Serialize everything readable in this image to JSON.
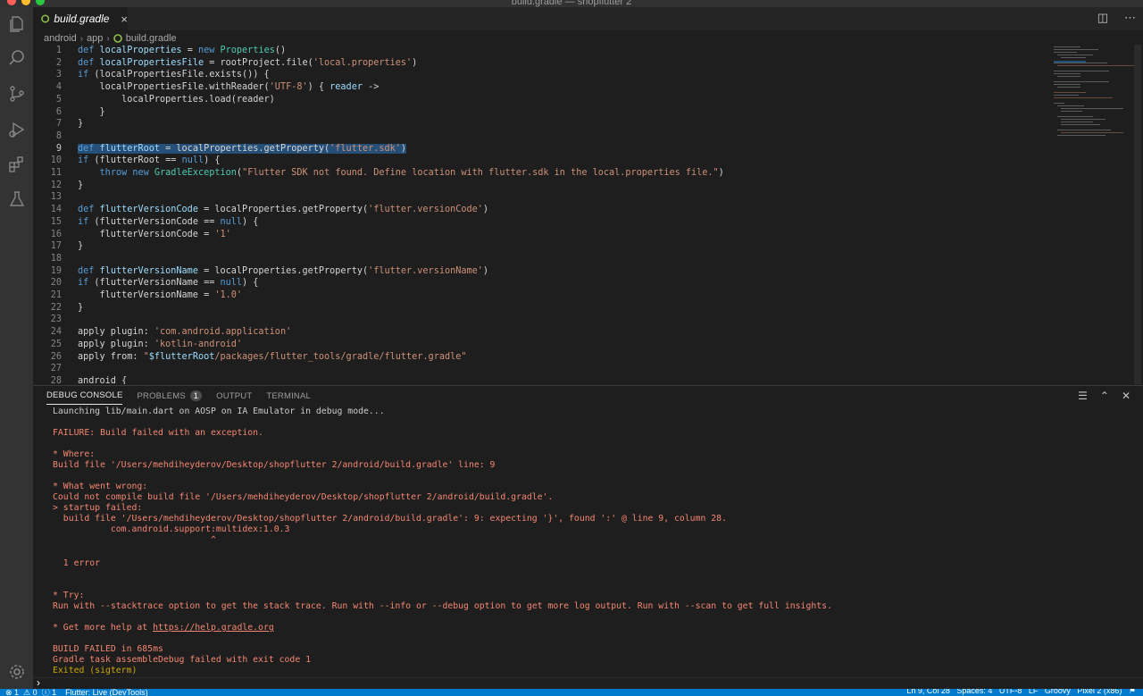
{
  "window": {
    "title": "build.gradle — shopflutter 2"
  },
  "activity_bar": {
    "icons": [
      "files-icon",
      "search-icon",
      "source-control-icon",
      "run-debug-icon",
      "extensions-icon",
      "testing-icon",
      "gear-icon"
    ]
  },
  "tab": {
    "label": "build.gradle",
    "close": "×"
  },
  "breadcrumb": [
    "android",
    "app",
    "build.gradle"
  ],
  "editor": {
    "line_numbers": [
      "1",
      "2",
      "3",
      "4",
      "5",
      "6",
      "7",
      "8",
      "9",
      "10",
      "11",
      "12",
      "13",
      "14",
      "15",
      "16",
      "17",
      "18",
      "19",
      "20",
      "21",
      "22",
      "23",
      "24",
      "25",
      "26",
      "27",
      "28"
    ]
  },
  "panel": {
    "tabs": [
      "DEBUG CONSOLE",
      "PROBLEMS",
      "OUTPUT",
      "TERMINAL"
    ],
    "problems_count": "1",
    "console_lines": [
      "Launching lib/main.dart on AOSP on IA Emulator in debug mode...",
      "FAILURE: Build failed with an exception.",
      "* Where:",
      "Build file '/Users/mehdiheyderov/Desktop/shopflutter 2/android/build.gradle' line: 9",
      "* What went wrong:",
      "Could not compile build file '/Users/mehdiheyderov/Desktop/shopflutter 2/android/build.gradle'.",
      "> startup failed:",
      "  build file '/Users/mehdiheyderov/Desktop/shopflutter 2/android/build.gradle': 9: expecting '}', found ':' @ line 9, column 28.",
      "           com.android.support:multidex:1.0.3",
      "                              ^",
      "  1 error",
      "* Try:",
      "Run with --stacktrace option to get the stack trace. Run with --info or --debug option to get more log output. Run with --scan to get full insights.",
      "* Get more help at ",
      "https://help.gradle.org",
      "BUILD FAILED in 685ms",
      "Gradle task assembleDebug failed with exit code 1",
      "Exited (sigterm)"
    ]
  },
  "status_bar": {
    "left": "⊗ 1  ⚠ 0  ⓘ 1    Flutter: Live (DevTools)",
    "right": "Ln 9, Col 28   Spaces: 4   UTF-8   LF   Groovy   Pixel 2 (x86)   ⚑"
  }
}
